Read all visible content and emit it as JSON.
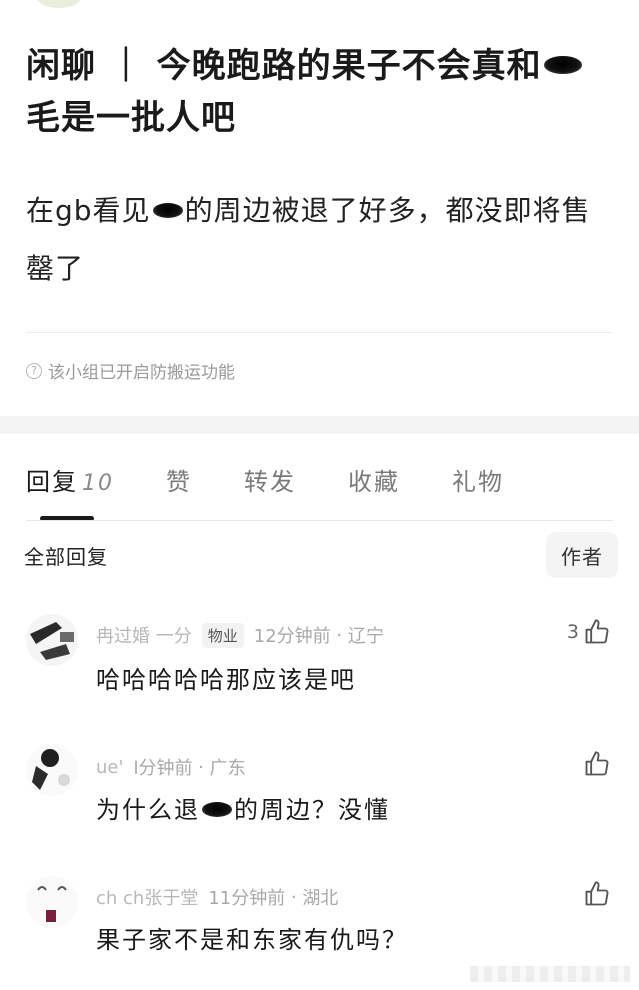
{
  "post": {
    "title_line1": "闲聊 ｜ 今晚跑路的果子不会真和",
    "title_line2": "毛是一批人吧",
    "body_part1": "在gb看见",
    "body_part2": "的周边被退了好多，都没即将售",
    "body_line2": "罄了",
    "anti_copy_notice": "该小组已开启防搬运功能"
  },
  "tabs": [
    {
      "label": "回复",
      "count": "10",
      "active": true
    },
    {
      "label": "赞"
    },
    {
      "label": "转发"
    },
    {
      "label": "收藏"
    },
    {
      "label": "礼物"
    }
  ],
  "replies_header": {
    "title": "全部回复",
    "sort_label": "作者"
  },
  "comments": [
    {
      "user": "冉过婚     一分",
      "badge": "物业",
      "time": "12分钟前",
      "region": "辽宁",
      "text": "哈哈哈哈哈那应该是吧",
      "likes": "3"
    },
    {
      "user": "ue'   ",
      "time": "l分钟前",
      "region": "广东",
      "text_part1": "为什么退",
      "text_part2": "的周边？没懂",
      "likes": ""
    },
    {
      "user": "ch   ch张于堂",
      "time": "11分钟前",
      "region": "湖北",
      "text": "果子家不是和东家有仇吗？",
      "likes": ""
    }
  ],
  "colors": {
    "accent": "#1a1a1a",
    "meta": "#a8a8a8",
    "section_gap": "#f3f3f3"
  },
  "icons": [
    "blackhole-icon",
    "help-icon",
    "thumbs-up-icon"
  ]
}
